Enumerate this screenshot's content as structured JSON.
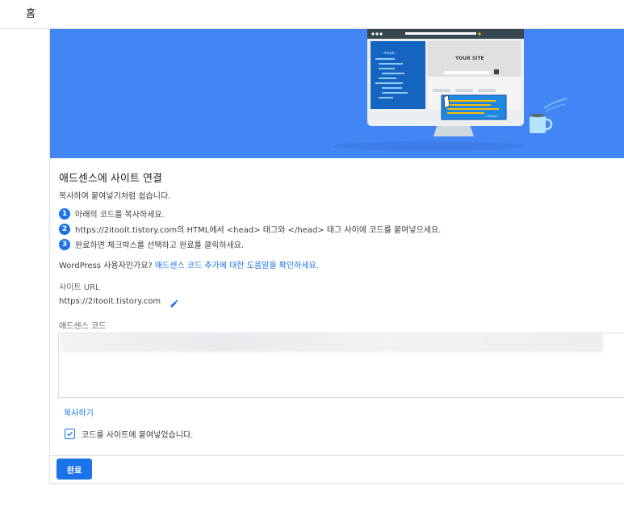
{
  "topbar": {
    "home_label": "홈"
  },
  "banner": {
    "site_text": "YOUR SITE",
    "head_tag": "<head>",
    "head_close_tag": "</head>"
  },
  "dialog": {
    "title": "애드센스에 사이트 연결",
    "subtitle": "복사하여 붙여넣기처럼 쉽습니다.",
    "steps": [
      {
        "num": "1",
        "text": "아래의 코드를 복사하세요."
      },
      {
        "num": "2",
        "text": "https://2itooit.tistory.com의 HTML에서 <head> 태그와 </head> 태그 사이에 코드를 붙여넣으세요."
      },
      {
        "num": "3",
        "text": "완료하면 체크박스를 선택하고 완료를 클릭하세요."
      }
    ],
    "wp_question": "WordPress 사용자인가요? ",
    "wp_link": "애드센스 코드 추가에 대한 도움말을 확인하세요.",
    "site_url_label": "사이트 URL",
    "site_url_value": "https://2itooit.tistory.com",
    "code_label": "애드센스 코드",
    "copy_label": "복사하기",
    "checkbox_label": "코드를 사이트에 붙여넣었습니다.",
    "checkbox_checked": true,
    "done_label": "완료"
  },
  "colors": {
    "accent": "#1a73e8",
    "banner_blue": "#4285f4"
  }
}
